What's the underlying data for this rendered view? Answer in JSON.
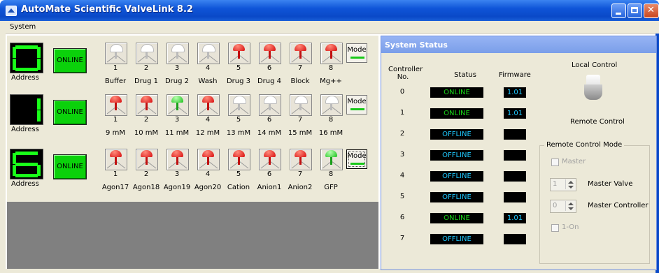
{
  "window": {
    "title": "AutoMate Scientific ValveLink 8.2"
  },
  "menu": {
    "system": "System"
  },
  "controllers": [
    {
      "digit": "0",
      "address_label": "Address",
      "online": "ONLINE",
      "valves": [
        {
          "num": "1",
          "name": "Buffer",
          "state": "off"
        },
        {
          "num": "2",
          "name": "Drug 1",
          "state": "off"
        },
        {
          "num": "3",
          "name": "Drug 2",
          "state": "off"
        },
        {
          "num": "4",
          "name": "Wash",
          "state": "off"
        },
        {
          "num": "5",
          "name": "Drug 3",
          "state": "red"
        },
        {
          "num": "6",
          "name": "Drug 4",
          "state": "red"
        },
        {
          "num": "7",
          "name": "Block",
          "state": "red"
        },
        {
          "num": "8",
          "name": "Mg++",
          "state": "red"
        }
      ],
      "mode": "Mode"
    },
    {
      "digit": "1",
      "address_label": "Address",
      "online": "ONLINE",
      "valves": [
        {
          "num": "1",
          "name": "9 mM",
          "state": "red"
        },
        {
          "num": "2",
          "name": "10 mM",
          "state": "red"
        },
        {
          "num": "3",
          "name": "11 mM",
          "state": "green"
        },
        {
          "num": "4",
          "name": "12 mM",
          "state": "red"
        },
        {
          "num": "5",
          "name": "13 mM",
          "state": "off"
        },
        {
          "num": "6",
          "name": "14 mM",
          "state": "off"
        },
        {
          "num": "7",
          "name": "15 mM",
          "state": "off"
        },
        {
          "num": "8",
          "name": "16 mM",
          "state": "off"
        }
      ],
      "mode": "Mode"
    },
    {
      "digit": "6",
      "address_label": "Address",
      "online": "ONLINE",
      "valves": [
        {
          "num": "1",
          "name": "Agon17",
          "state": "red"
        },
        {
          "num": "2",
          "name": "Agon18",
          "state": "red"
        },
        {
          "num": "3",
          "name": "Agon19",
          "state": "red"
        },
        {
          "num": "4",
          "name": "Agon20",
          "state": "red"
        },
        {
          "num": "5",
          "name": "Cation",
          "state": "red"
        },
        {
          "num": "6",
          "name": "Anion1",
          "state": "red"
        },
        {
          "num": "7",
          "name": "Anion2",
          "state": "red"
        },
        {
          "num": "8",
          "name": "GFP",
          "state": "green"
        }
      ],
      "mode": "Mode"
    }
  ],
  "status_panel": {
    "title": "System Status",
    "col_controller": "Controller No.",
    "col_status": "Status",
    "col_firmware": "Firmware",
    "rows": [
      {
        "no": "0",
        "status": "ONLINE",
        "firmware": "1.01"
      },
      {
        "no": "1",
        "status": "ONLINE",
        "firmware": "1.01"
      },
      {
        "no": "2",
        "status": "OFFLINE",
        "firmware": ""
      },
      {
        "no": "3",
        "status": "OFFLINE",
        "firmware": ""
      },
      {
        "no": "4",
        "status": "OFFLINE",
        "firmware": ""
      },
      {
        "no": "5",
        "status": "OFFLINE",
        "firmware": ""
      },
      {
        "no": "6",
        "status": "ONLINE",
        "firmware": "1.01"
      },
      {
        "no": "7",
        "status": "OFFLINE",
        "firmware": ""
      }
    ],
    "local_control": "Local Control",
    "remote_control": "Remote Control",
    "remote_mode": {
      "title": "Remote Control Mode",
      "master": "Master",
      "master_valve_value": "1",
      "master_valve_label": "Master Valve",
      "master_controller_value": "0",
      "master_controller_label": "Master Controller",
      "one_on": "1-On"
    }
  },
  "colors": {
    "online_green": "#0bd10b",
    "segment_green": "#19ff19",
    "offline_blue": "#1ec9ff",
    "titlebar_blue": "#0a49c7"
  }
}
